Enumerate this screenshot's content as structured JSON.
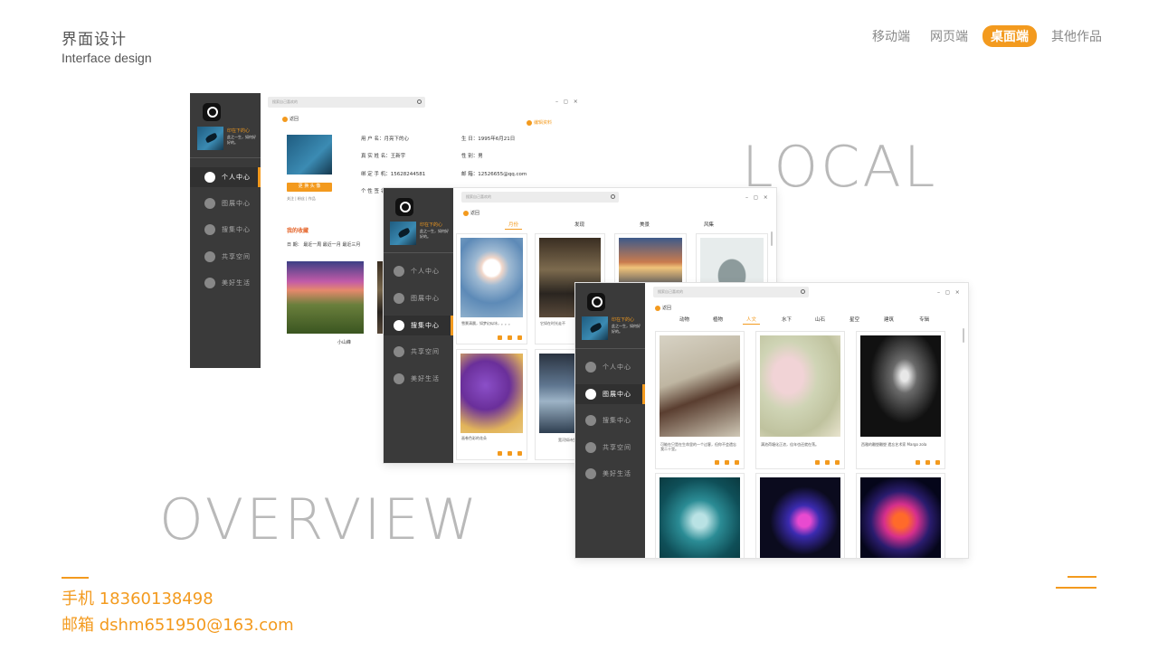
{
  "header": {
    "title": "界面设计",
    "subtitle": "Interface design"
  },
  "top_nav": [
    {
      "label": "移动端"
    },
    {
      "label": "网页端"
    },
    {
      "label": "桌面端",
      "active": true
    },
    {
      "label": "其他作品"
    }
  ],
  "big_words": {
    "local": "LOCAL",
    "overview": "OVERVIEW"
  },
  "contact": {
    "phone_label": "手机",
    "phone": "18360138498",
    "email_label": "邮箱",
    "email": "dshm651950@163.com"
  },
  "app": {
    "user_name": "印在下的心",
    "user_motto": "此之一生，如何好好的。",
    "menu": [
      "个人中心",
      "图展中心",
      "搜集中心",
      "共享空间",
      "美好生活"
    ],
    "search_placeholder": "搜索自己喜欢的",
    "window_controls": "– ◻ ×",
    "back_label": "返回"
  },
  "window1": {
    "edit_label": "编辑资料",
    "avatar_button": "更 换 头 像",
    "stats": "关注 | 粉丝 | 作品",
    "profile": {
      "nickname": "用 户 名：月亮下的心",
      "realname": "真 实 姓 名：王新宇",
      "phone": "绑 定 手 机：15628244581",
      "signature": "个 性 签 名：",
      "birthday": "生   日：1995年6月21日",
      "gender": "性   别：男",
      "email": "邮   箱：12526655@qq.com"
    },
    "section_title": "我的收藏",
    "filter_label": "日 期：",
    "filter_options": [
      "最近一周",
      "最近一月",
      "最近三月"
    ],
    "item_label": "小山峰"
  },
  "window2": {
    "tabs": [
      "月份",
      "发现",
      "美景",
      "风集"
    ],
    "cards": [
      {
        "caption": "雪景清晨，如梦幻似冰，。。。"
      },
      {
        "caption": "它如在时光走不"
      },
      {
        "caption": ""
      },
      {
        "caption": ""
      },
      {
        "caption": "画卷色彩的花朵"
      },
      {
        "caption": "宽河如诗生"
      }
    ]
  },
  "window3": {
    "tabs": [
      "动物",
      "植物",
      "人文",
      "水下",
      "山石",
      "星空",
      "建筑",
      "专辑"
    ],
    "cards": [
      {
        "caption": "可能在只是在生命里的一个过客，但你不会遗忘我二十里。"
      },
      {
        "caption": "满池荷塘化正浓，佳年也还就在荡。"
      },
      {
        "caption": "西雅的雕塑雕塑 遗忘艺术家 Margo zola"
      },
      {
        "caption": ""
      },
      {
        "caption": ""
      },
      {
        "caption": ""
      }
    ]
  },
  "colors": {
    "accent": "#f39a1e",
    "sidebar": "#3a3a3a",
    "big_word": "#b9b9b9"
  }
}
